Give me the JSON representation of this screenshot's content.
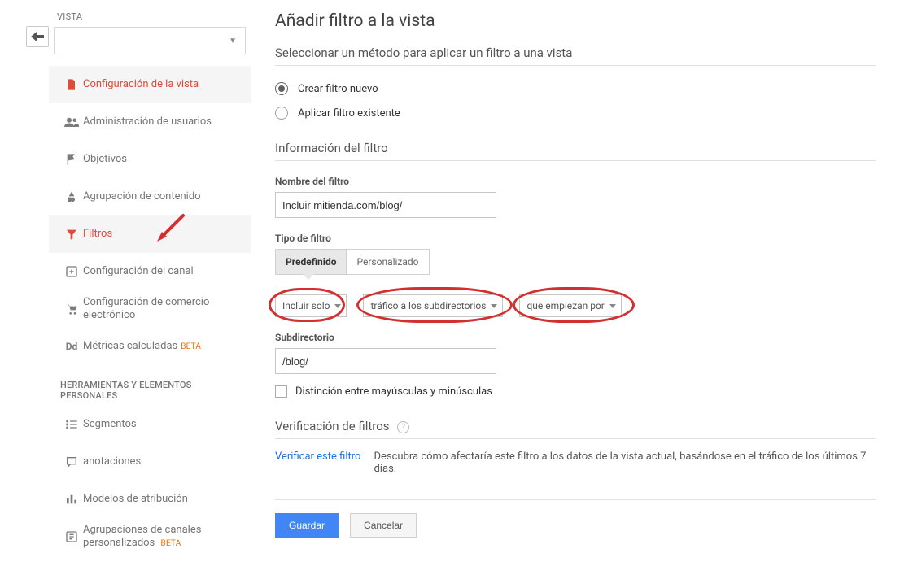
{
  "sidebar": {
    "header_label": "VISTA",
    "view_selector_value": "",
    "items": [
      {
        "label": "Configuración de la vista",
        "icon": "file"
      },
      {
        "label": "Administración de usuarios",
        "icon": "users"
      },
      {
        "label": "Objetivos",
        "icon": "flag"
      },
      {
        "label": "Agrupación de contenido",
        "icon": "group"
      },
      {
        "label": "Filtros",
        "icon": "funnel"
      },
      {
        "label": "Configuración del canal",
        "icon": "channel"
      },
      {
        "label": "Configuración de comercio electrónico",
        "icon": "cart"
      },
      {
        "label": "Métricas calculadas",
        "icon": "dd",
        "beta": "BETA"
      }
    ],
    "tools_heading": "HERRAMIENTAS Y ELEMENTOS PERSONALES",
    "tools": [
      {
        "label": "Segmentos",
        "icon": "segments"
      },
      {
        "label": "anotaciones",
        "icon": "annotation"
      },
      {
        "label": "Modelos de atribución",
        "icon": "bars"
      },
      {
        "label": "Agrupaciones de canales personalizados",
        "icon": "channel",
        "beta": "BETA"
      }
    ]
  },
  "main": {
    "title": "Añadir filtro a la vista",
    "select_method_heading": "Seleccionar un método para aplicar un filtro a una vista",
    "radio_new": "Crear filtro nuevo",
    "radio_existing": "Aplicar filtro existente",
    "info_heading": "Información del filtro",
    "name_label": "Nombre del filtro",
    "name_value": "Incluir mitienda.com/blog/",
    "type_label": "Tipo de filtro",
    "tab_predef": "Predefinido",
    "tab_custom": "Personalizado",
    "pill1": "Incluir solo",
    "pill2": "tráfico a los subdirectorios",
    "pill3": "que empiezan por",
    "subdir_label": "Subdirectorio",
    "subdir_value": "/blog/",
    "case_sensitive": "Distinción entre mayúsculas y minúsculas",
    "verify_heading": "Verificación de filtros",
    "verify_link": "Verificar este filtro",
    "verify_text": "Descubra cómo afectaría este filtro a los datos de la vista actual, basándose en el tráfico de los últimos 7 días.",
    "save": "Guardar",
    "cancel": "Cancelar"
  }
}
